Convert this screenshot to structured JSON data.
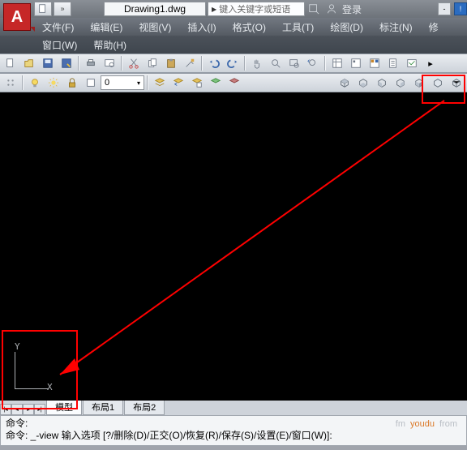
{
  "logo_letter": "A",
  "filename": "Drawing1.dwg",
  "search_placeholder": "键入关键字或短语",
  "login_text": "登录",
  "menus": {
    "file": "文件(F)",
    "edit": "编辑(E)",
    "view": "视图(V)",
    "insert": "插入(I)",
    "format": "格式(O)",
    "tools": "工具(T)",
    "draw": "绘图(D)",
    "dimension": "标注(N)",
    "modify": "修",
    "window": "窗口(W)",
    "help": "帮助(H)"
  },
  "layer_value": "0",
  "ucs": {
    "x": "X",
    "y": "Y"
  },
  "tabs": {
    "model": "模型",
    "layout1": "布局1",
    "layout2": "布局2"
  },
  "cmd": {
    "line1": "命令:",
    "line2_label": "命令: ",
    "line2_cmd": "_-view",
    "line2_rest": " 输入选项 [?/删除(D)/正交(O)/恢复(R)/保存(S)/设置(E)/窗口(W)]:"
  },
  "watermark": {
    "a": "fm",
    "b": "youdu",
    "c": "from"
  }
}
